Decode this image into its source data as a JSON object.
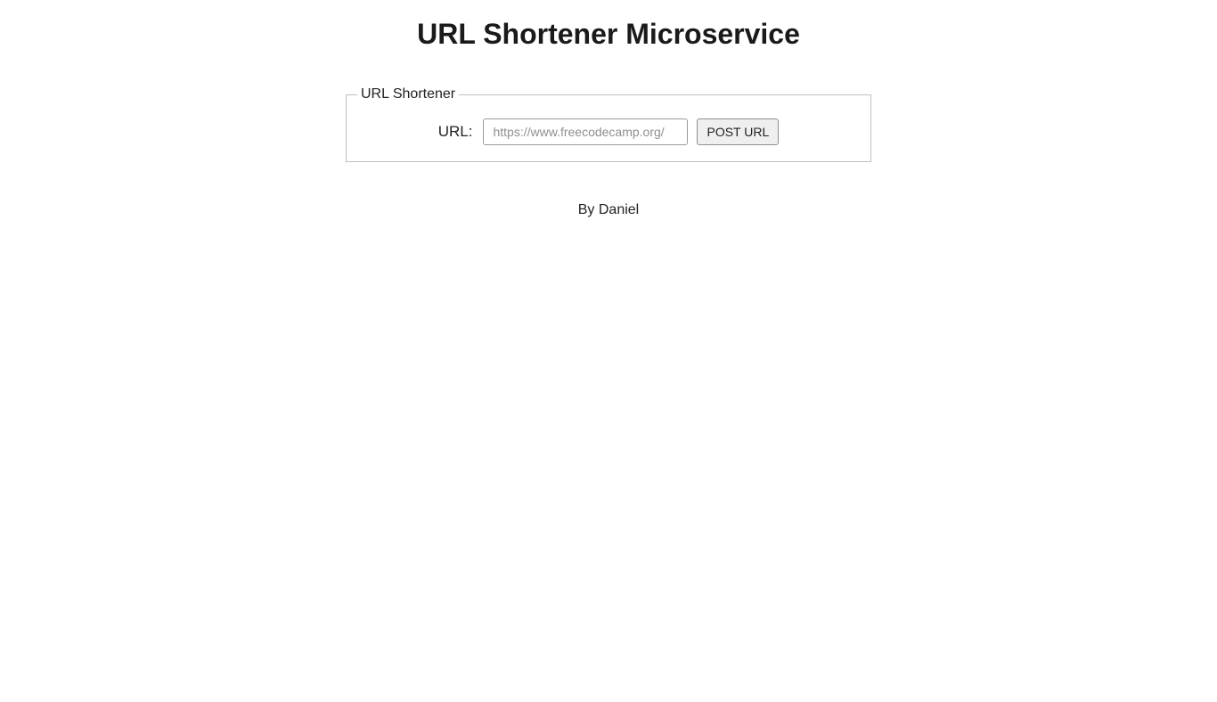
{
  "header": {
    "title": "URL Shortener Microservice"
  },
  "form": {
    "legend": "URL Shortener",
    "url_label": "URL:",
    "url_placeholder": "https://www.freecodecamp.org/",
    "url_value": "",
    "submit_label": "POST URL"
  },
  "footer": {
    "credit": "By Daniel"
  }
}
